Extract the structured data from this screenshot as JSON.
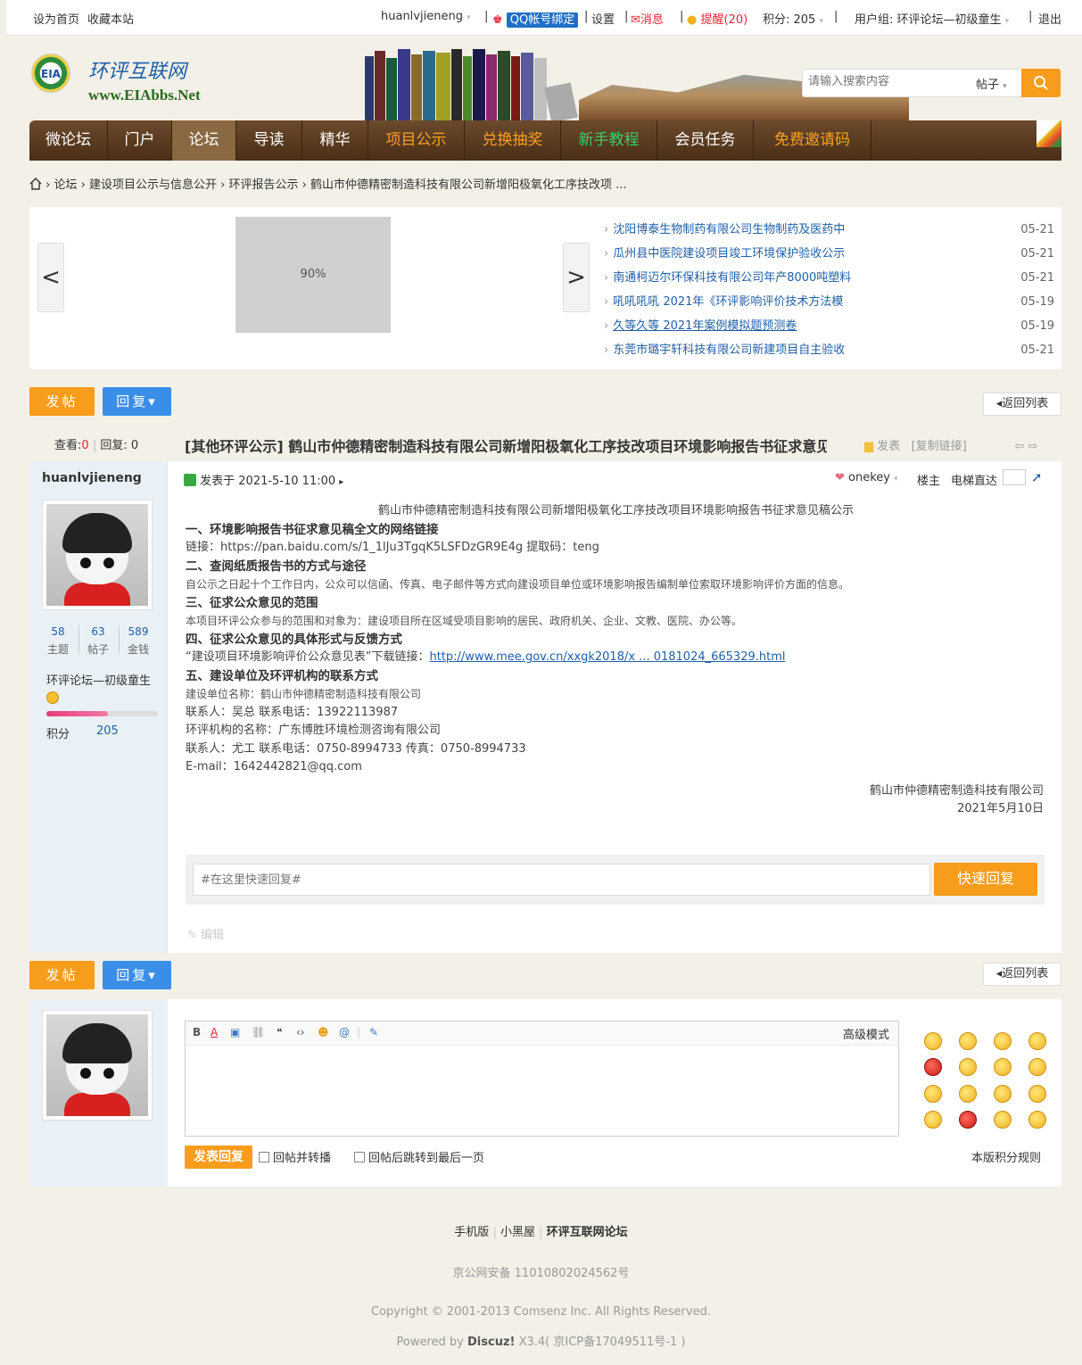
{
  "topbar": {
    "set_home": "设为首页",
    "bookmark": "收藏本站",
    "username": "huanlvjieneng",
    "qq_bind": "QQ帐号绑定",
    "settings": "设置",
    "messages": "消息",
    "reminders": "提醒(20)",
    "points": "积分: 205",
    "user_group": "用户组: 环评论坛—初级童生",
    "logout": "退出"
  },
  "header": {
    "logo_badge": "EIA",
    "logo_cn": "环评互联网",
    "logo_en": "www.EIAbbs.Net",
    "search_placeholder": "请输入搜索内容",
    "search_type": "帖子"
  },
  "nav": {
    "items": [
      {
        "label": "微论坛"
      },
      {
        "label": "门户"
      },
      {
        "label": "论坛"
      },
      {
        "label": "导读"
      },
      {
        "label": "精华"
      },
      {
        "label": "项目公示"
      },
      {
        "label": "兑换抽奖"
      },
      {
        "label": "新手教程"
      },
      {
        "label": "会员任务"
      },
      {
        "label": "免费邀请码"
      }
    ]
  },
  "breadcrumb": {
    "items": [
      "论坛",
      "建设项目公示与信息公开",
      "环评报告公示",
      "鹤山市仲德精密制造科技有限公司新增阳极氧化工序技改项 ..."
    ]
  },
  "slider": {
    "prev": "<",
    "next": ">",
    "image_text": "90%",
    "news": [
      {
        "title": "沈阳博泰生物制药有限公司生物制药及医药中",
        "date": "05-21"
      },
      {
        "title": "瓜州县中医院建设项目竣工环境保护验收公示",
        "date": "05-21"
      },
      {
        "title": "南通柯迈尔环保科技有限公司年产8000吨塑料",
        "date": "05-21"
      },
      {
        "title": "吼吼吼吼 2021年《环评影响评价技术方法模",
        "date": "05-19"
      },
      {
        "title": "久等久等 2021年案例模拟题预测卷",
        "date": "05-19"
      },
      {
        "title": "东莞市璐宇轩科技有限公司新建项目自主验收",
        "date": "05-21"
      }
    ]
  },
  "actions": {
    "post": "发帖",
    "reply": "回复▾",
    "back": "◂返回列表"
  },
  "thread": {
    "views_label": "查看:",
    "views": "0",
    "replies_label": "回复:",
    "replies": "0",
    "title": "[其他环评公示] 鹤山市仲德精密制造科技有限公司新增阳极氧化工序技改项目环境影响报告书征求意见...",
    "publish": "发表",
    "copy_link": "[复制链接]"
  },
  "post": {
    "author": "huanlvjieneng",
    "stats": [
      {
        "num": "58",
        "label": "主题"
      },
      {
        "num": "63",
        "label": "帖子"
      },
      {
        "num": "589",
        "label": "金钱"
      }
    ],
    "group": "环评论坛—初级童生",
    "level_progress": 0.55,
    "points_label": "积分",
    "points": "205",
    "posted_at": "发表于 2021-5-10 11:00",
    "onekey": "onekey",
    "floor": "楼主",
    "elevator": "电梯直达",
    "content": {
      "title": "鹤山市仲德精密制造科技有限公司新增阳极氧化工序技改项目环境影响报告书征求意见稿公示",
      "h1": "一、环境影响报告书征求意见稿全文的网络链接",
      "p1": "链接：https://pan.baidu.com/s/1_1lJu3TgqK5LSFDzGR9E4g 提取码：teng",
      "h2": "二、查阅纸质报告书的方式与途径",
      "p2": "自公示之日起十个工作日内，公众可以信函、传真、电子邮件等方式向建设项目单位或环境影响报告编制单位索取环境影响评价方面的信息。",
      "h3": "三、征求公众意见的范围",
      "p3": "本项目环评公众参与的范围和对象为：建设项目所在区域受项目影响的居民、政府机关、企业、文教、医院、办公等。",
      "h4": "四、征求公众意见的具体形式与反馈方式",
      "p4_prefix": "“建设项目环境影响评价公众意见表”下载链接：",
      "p4_link": "http://www.mee.gov.cn/xxgk2018/x ... 0181024_665329.html",
      "h5": "五、建设单位及环评机构的联系方式",
      "l1": "建设单位名称：鹤山市仲德精密制造科技有限公司",
      "l2": "联系人：吴总    联系电话：13922113987",
      "l3": "环评机构的名称：广东博胜环境检测咨询有限公司",
      "l4": "联系人：尤工    联系电话：0750-8994733    传真：0750-8994733",
      "l5": "E-mail：1642442821@qq.com",
      "sign1": "鹤山市仲德精密制造科技有限公司",
      "sign2": "2021年5月10日"
    },
    "quick_reply_placeholder": "#在这里快速回复#",
    "quick_reply_button": "快速回复",
    "edit": "编辑"
  },
  "editor": {
    "advanced": "高级模式",
    "submit": "发表回复",
    "option1": "回帖并转播",
    "option2": "回帖后跳转到最后一页",
    "rules": "本版积分规则"
  },
  "footer": {
    "mobile": "手机版",
    "blackroom": "小黑屋",
    "site": "环评互联网论坛",
    "icp_police": "京公网安备 11010802024562号",
    "copyright": "Copyright © 2001-2013 Comsenz Inc.  All Rights Reserved.",
    "powered_prefix": "Powered by ",
    "powered_name": "Discuz!",
    "powered_suffix": " X3.4( 京ICP备17049511号-1 )"
  },
  "colors": {
    "accent_orange": "#f89c1c",
    "accent_blue": "#3b8ee8",
    "nav_brown": "#5a3a1e",
    "link_blue": "#1f5fa8"
  }
}
